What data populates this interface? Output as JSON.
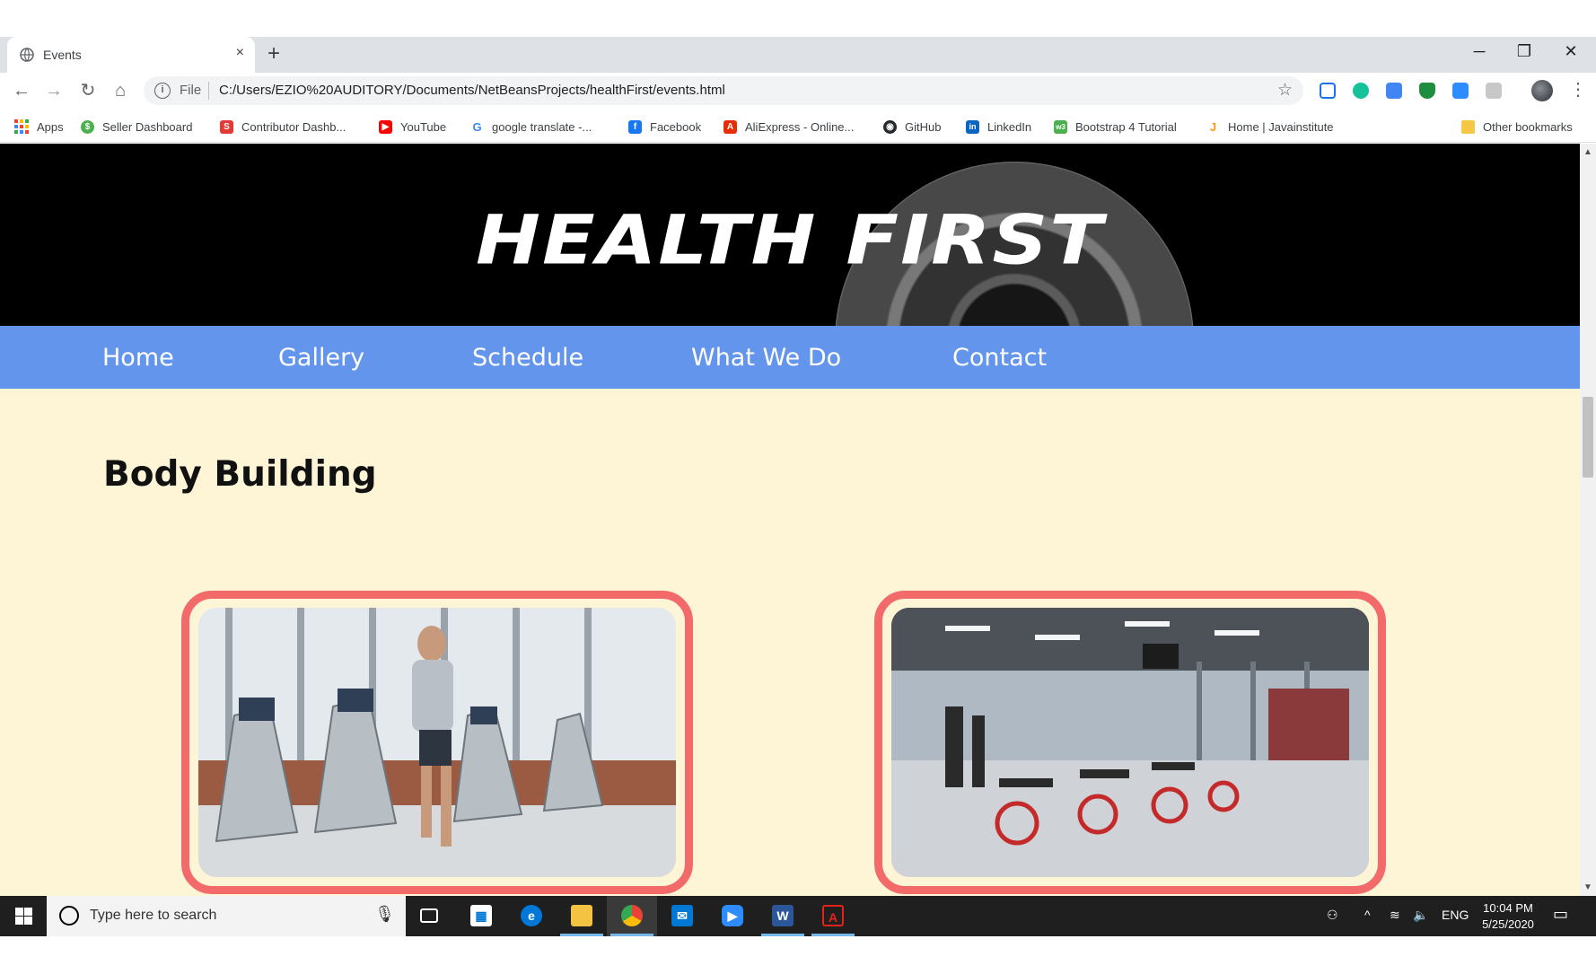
{
  "browser": {
    "tab_title": "Events",
    "tab_close": "×",
    "new_tab": "+",
    "window_controls": {
      "minimize": "─",
      "restore": "❐",
      "close": "✕"
    },
    "nav": {
      "back": "←",
      "forward": "→",
      "reload": "↻",
      "home": "⌂"
    },
    "omnibox": {
      "info": "i",
      "scheme_label": "File",
      "url": "C:/Users/EZIO%20AUDITORY/Documents/NetBeansProjects/healthFirst/events.html",
      "star": "☆"
    },
    "menu": "⋮"
  },
  "bookmarks": {
    "items": [
      {
        "label": "Apps",
        "icon": "apps-grid-icon"
      },
      {
        "label": "Seller Dashboard",
        "icon": "seller-icon",
        "color": "#4caf50",
        "glyph": "$"
      },
      {
        "label": "Contributor Dashb...",
        "icon": "contributor-icon",
        "color": "#e53935",
        "glyph": "S"
      },
      {
        "label": "YouTube",
        "icon": "youtube-icon",
        "color": "#ff0000",
        "glyph": "▶"
      },
      {
        "label": "google translate -...",
        "icon": "google-icon",
        "color": "#4285f4",
        "glyph": "G"
      },
      {
        "label": "Facebook",
        "icon": "facebook-icon",
        "color": "#1877f2",
        "glyph": "f"
      },
      {
        "label": "AliExpress - Online...",
        "icon": "aliexpress-icon",
        "color": "#e62e04",
        "glyph": "A"
      },
      {
        "label": "GitHub",
        "icon": "github-icon",
        "color": "#24292e",
        "glyph": "◉"
      },
      {
        "label": "LinkedIn",
        "icon": "linkedin-icon",
        "color": "#0a66c2",
        "glyph": "in"
      },
      {
        "label": "Bootstrap 4 Tutorial",
        "icon": "w3schools-icon",
        "color": "#4caf50",
        "glyph": "w3"
      },
      {
        "label": "Home | Javainstitute",
        "icon": "java-icon",
        "color": "#f89820",
        "glyph": "J"
      }
    ],
    "other": "Other bookmarks"
  },
  "page": {
    "logo_text": "HEALTH FIRST",
    "nav_links": [
      "Home",
      "Gallery",
      "Schedule",
      "What We Do",
      "Contact"
    ],
    "section_title": "Body Building",
    "colors": {
      "nav_bg": "#6495ed",
      "page_bg": "#fef5d7",
      "card_border": "#f26a6a"
    }
  },
  "taskbar": {
    "search_placeholder": "Type here to search",
    "apps": [
      "task-view",
      "store",
      "edge",
      "file-explorer",
      "chrome",
      "mail",
      "zoom",
      "word",
      "acrobat"
    ],
    "language": "ENG",
    "time": "10:04 PM",
    "date": "5/25/2020"
  }
}
